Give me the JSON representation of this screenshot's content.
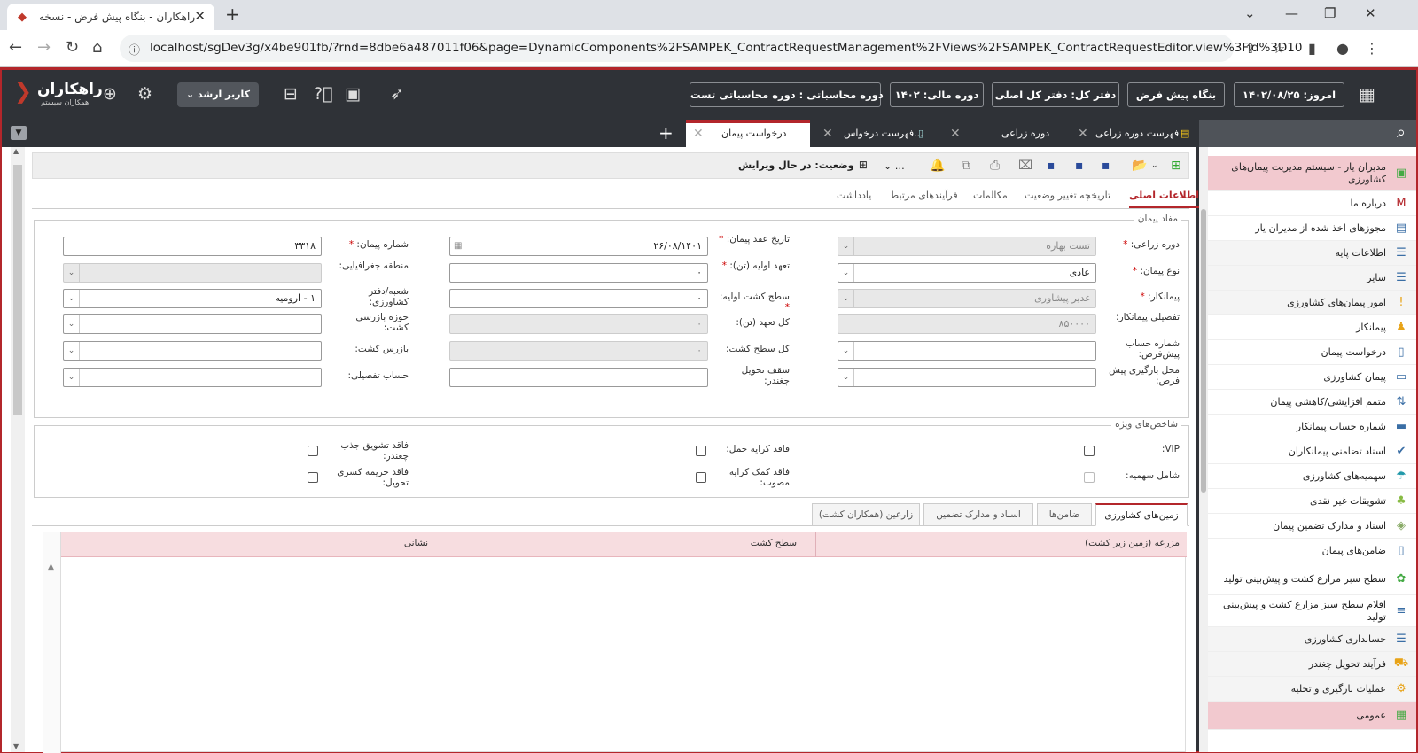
{
  "browser": {
    "tab_title": "راهکاران - بنگاه پیش فرض - نسخه",
    "url": "localhost/sgDev3g/x4be901fb/?rnd=8dbe6a487011f06&page=DynamicComponents%2FSAMPEK_ContractRequestManagement%2FViews%2FSAMPEK_ContractRequestEditor.view%3Fid%3D10"
  },
  "header": {
    "logo": "راهکاران",
    "logo_sub": "همکاران سیستم",
    "user": "کاربر ارشد",
    "period": "دوره محاسباتی : دوره محاسباتی تست",
    "fiscal": "دوره مالی: ۱۴۰۲",
    "ledger": "دفتر کل: دفتر کل اصلی",
    "company": "بنگاه پیش فرض",
    "today": "امروز: ۱۴۰۲/۰۸/۲۵"
  },
  "app_tabs": [
    "فهرست دوره زراعی",
    "دوره زراعی",
    "فهرست درخواس...",
    "درخواست پیمان"
  ],
  "sidebar": [
    {
      "label": "مدیران یار - سیستم مدیریت پیمان‌های کشاورزی",
      "icon": "app-icon"
    },
    {
      "label": "درباره ما",
      "icon": "logo-icon"
    },
    {
      "label": "مجوزهای اخذ شده از مدیران یار",
      "icon": "certificate-icon"
    },
    {
      "label": "اطلاعات پایه",
      "icon": "list-icon"
    },
    {
      "label": "سایر",
      "icon": "list-icon"
    },
    {
      "label": "امور پیمان‌های کشاورزی",
      "icon": "info-icon"
    },
    {
      "label": "پیمانکار",
      "icon": "contractor-icon"
    },
    {
      "label": "درخواست پیمان",
      "icon": "document-icon"
    },
    {
      "label": "پیمان کشاورزی",
      "icon": "contract-icon"
    },
    {
      "label": "متمم افزایشی/کاهشی پیمان",
      "icon": "updown-icon"
    },
    {
      "label": "شماره حساب پیمانکار",
      "icon": "card-icon"
    },
    {
      "label": "اسناد تضامنی پیمانکاران",
      "icon": "doc-check-icon"
    },
    {
      "label": "سهمیه‌های کشاورزی",
      "icon": "umbrella-icon"
    },
    {
      "label": "تشویقات غیر نقدی",
      "icon": "gift-icon"
    },
    {
      "label": "اسناد و مدارک تضمین پیمان",
      "icon": "folder-icon"
    },
    {
      "label": "ضامن‌های پیمان",
      "icon": "guarantor-icon"
    },
    {
      "label": "سطح سبز مزارع کشت و پیش‌بینی تولید",
      "icon": "plant-icon"
    },
    {
      "label": "اقلام سطح سبز مزارع کشت و پیش‌بینی تولید",
      "icon": "items-icon"
    },
    {
      "label": "حسابداری کشاورزی",
      "icon": "list-icon"
    },
    {
      "label": "فرآیند تحویل چغندر",
      "icon": "truck-icon"
    },
    {
      "label": "عملیات بارگیری و تخلیه",
      "icon": "gear-icon"
    },
    {
      "label": "عمومی",
      "icon": "module-icon"
    }
  ],
  "toolbar": {
    "status": "وضعیت: در حال ویرایش"
  },
  "form_tabs": [
    "اطلاعات اصلی",
    "تاریخچه تغییر وضعیت",
    "مکالمات",
    "فرآیندهای مرتبط",
    "یادداشت"
  ],
  "section1": {
    "legend": "مفاد پیمان",
    "col1": [
      {
        "label": "دوره زراعی:",
        "req": true,
        "value": "تست بهاره",
        "type": "dd-dis"
      },
      {
        "label": "نوع پیمان:",
        "req": true,
        "value": "عادی",
        "type": "dd"
      },
      {
        "label": "پیمانکار:",
        "req": true,
        "value": "غدیر پیشاوری",
        "type": "dd-dis"
      },
      {
        "label": "تفصیلی پیمانکار:",
        "req": false,
        "value": "۸۵۰۰۰۰",
        "type": "dis"
      },
      {
        "label": "شماره حساب پیش‌فرض:",
        "req": false,
        "value": "",
        "type": "dd"
      },
      {
        "label": "محل بارگیری پیش فرض:",
        "req": false,
        "value": "",
        "type": "dd"
      }
    ],
    "col2": [
      {
        "label": "تاریخ عقد پیمان:",
        "req": true,
        "value": "۲۶/۰۸/۱۴۰۱",
        "type": "date"
      },
      {
        "label": "تعهد اولیه (تن):",
        "req": true,
        "value": "۰",
        "type": "text"
      },
      {
        "label": "سطح کشت اولیه:",
        "req": true,
        "value": "۰",
        "type": "text"
      },
      {
        "label": "کل تعهد (تن):",
        "req": false,
        "value": "۰",
        "type": "dis"
      },
      {
        "label": "کل سطح کشت:",
        "req": false,
        "value": "۰",
        "type": "dis"
      },
      {
        "label": "سقف تحویل چغندر:",
        "req": false,
        "value": "",
        "type": "text"
      }
    ],
    "col3": [
      {
        "label": "شماره پیمان:",
        "req": true,
        "value": "۳۳۱۸",
        "type": "text"
      },
      {
        "label": "منطقه جغرافیایی:",
        "req": false,
        "value": "",
        "type": "dd-dis"
      },
      {
        "label": "شعبه/دفتر کشاورزی:",
        "req": false,
        "value": "۱ - ارومیه",
        "type": "dd"
      },
      {
        "label": "حوزه بازرسی کشت:",
        "req": false,
        "value": "",
        "type": "dd"
      },
      {
        "label": "بازرس کشت:",
        "req": false,
        "value": "",
        "type": "dd"
      },
      {
        "label": "حساب تفصیلی:",
        "req": false,
        "value": "",
        "type": "dd"
      }
    ]
  },
  "section2": {
    "legend": "شاخص‌های ویژه",
    "items": [
      {
        "label": "VIP:"
      },
      {
        "label": "شامل سهمیه:"
      },
      {
        "label": "فاقد کرایه حمل:"
      },
      {
        "label": "فاقد کمک کرایه مصوب:"
      },
      {
        "label": "فاقد تشویق جذب چغندر:"
      },
      {
        "label": "فاقد جریمه کسری تحویل:"
      }
    ]
  },
  "grid_tabs": [
    "زمین‌های کشاورزی",
    "ضامن‌ها",
    "اسناد و مدارک تضمین",
    "زارعین (همکاران کشت)"
  ],
  "grid_headers": [
    "مزرعه (زمین زیر کشت)",
    "سطح کشت",
    "نشانی"
  ]
}
